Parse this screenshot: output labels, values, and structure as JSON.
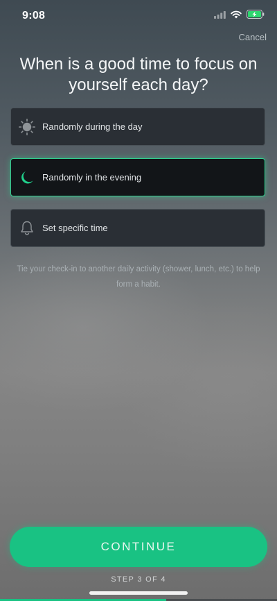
{
  "status_bar": {
    "time": "9:08",
    "signal_icon": "cellular-signal-icon",
    "wifi_icon": "wifi-icon",
    "battery_icon": "battery-charging-icon"
  },
  "header": {
    "cancel_label": "Cancel"
  },
  "question": {
    "title": "When is a good time to focus on yourself each day?"
  },
  "options": [
    {
      "label": "Randomly during the day",
      "icon": "sun-icon",
      "selected": false
    },
    {
      "label": "Randomly in the evening",
      "icon": "moon-icon",
      "selected": true
    },
    {
      "label": "Set specific time",
      "icon": "bell-icon",
      "selected": false
    }
  ],
  "hint": "Tie your check-in to another daily activity (shower, lunch, etc.) to help form a habit.",
  "footer": {
    "continue_label": "CONTINUE",
    "step_label": "STEP 3 OF 4"
  },
  "progress": {
    "current": 3,
    "total": 4,
    "fraction": 0.6
  },
  "colors": {
    "accent": "#19c283",
    "selected_border": "#2fd08e",
    "card_bg": "#2a2f35",
    "selected_bg": "#121518"
  }
}
